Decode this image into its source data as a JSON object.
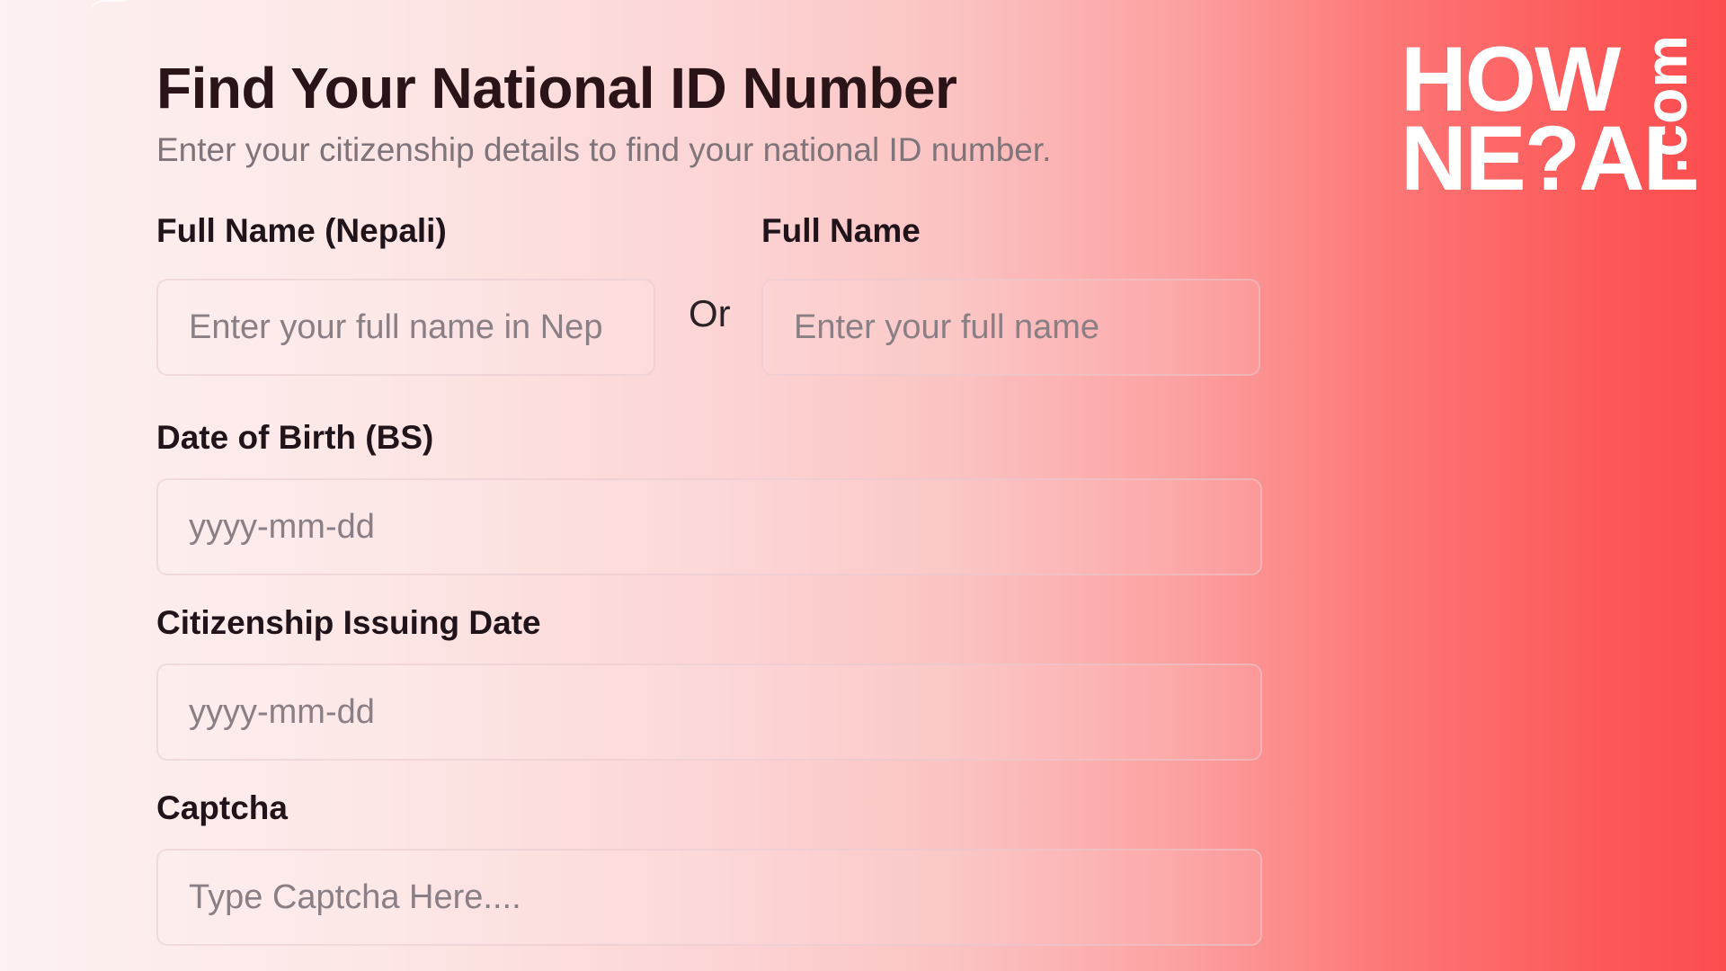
{
  "page": {
    "title": "Find Your National ID Number",
    "subtitle": "Enter your citizenship details to find your national ID number."
  },
  "form": {
    "full_name_nepali": {
      "label": "Full Name (Nepali)",
      "placeholder": "Enter your full name in Nep"
    },
    "or_text": "Or",
    "full_name": {
      "label": "Full Name",
      "placeholder": "Enter your full name"
    },
    "date_of_birth": {
      "label": "Date of Birth (BS)",
      "placeholder": "yyyy-mm-dd"
    },
    "citizenship_issuing_date": {
      "label": "Citizenship Issuing Date",
      "placeholder": "yyyy-mm-dd"
    },
    "captcha": {
      "label": "Captcha",
      "placeholder": "Type Captcha Here...."
    }
  },
  "logo": {
    "line1": "HOW",
    "line2": "NE?AL",
    "suffix": ".com"
  },
  "colors": {
    "gradient_start": "#fdf1f1",
    "gradient_end": "#fc4c4e",
    "title": "#2a1418",
    "subtitle": "#7f747a",
    "placeholder": "#8a7f85"
  }
}
